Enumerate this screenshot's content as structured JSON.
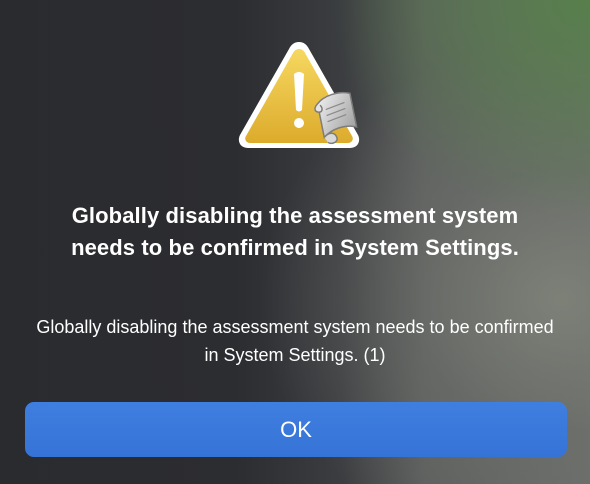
{
  "dialog": {
    "icon": "caution-script-icon",
    "title": "Globally disabling the assessment system needs to be confirmed in System Settings.",
    "message": "Globally disabling the assessment system needs to be confirmed in System Settings. (1)",
    "ok_label": "OK"
  },
  "colors": {
    "button_accent": "#3a78dc",
    "warning_yellow": "#e9be3a",
    "text": "#ffffff"
  }
}
